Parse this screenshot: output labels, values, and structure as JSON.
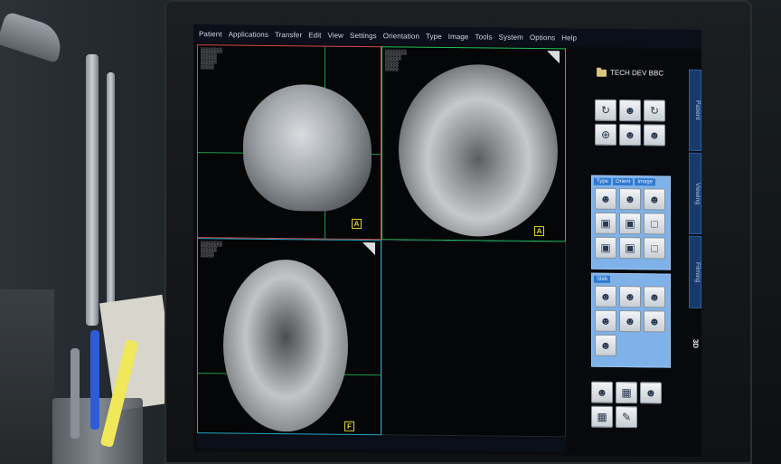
{
  "menu": [
    "Patient",
    "Applications",
    "Transfer",
    "Edit",
    "View",
    "Settings",
    "Orientation",
    "Type",
    "Image",
    "Tools",
    "System",
    "Options",
    "Help"
  ],
  "viewports": {
    "top_left": {
      "orient": "A"
    },
    "top_right": {
      "orient": "A"
    },
    "bottom_left": {
      "orient": "F"
    }
  },
  "panel": {
    "folder_label": "TECH DEV BBC",
    "side_tabs": [
      "Patient",
      "Viewing",
      "Filming"
    ],
    "mode_3d": "3D",
    "group1_tabs": [
      "Type",
      "Orient",
      "Image"
    ],
    "group2_tabs": [
      "Slab"
    ]
  },
  "icons": {
    "top_tools": [
      "rotate-icon",
      "head-icon",
      "rotate-icon",
      "orbit-icon",
      "head-icon",
      "head-icon"
    ],
    "group1_tools": [
      "head-icon",
      "head-icon",
      "head-icon",
      "cube-icon",
      "cube-icon",
      "square-icon",
      "cube-icon",
      "cube-icon",
      "square-icon"
    ],
    "group2_tools": [
      "head-icon",
      "head-icon",
      "head-icon",
      "head-icon",
      "head-icon",
      "head-icon",
      "head-icon"
    ],
    "bottom_tools": [
      "head-icon",
      "grid-icon",
      "head-icon",
      "grid-icon",
      "pen-icon"
    ]
  },
  "colors": {
    "crosshair": "#22c05a",
    "orient_marker": "#e0d32a",
    "panel_blue": "#7fb2e8",
    "tab_blue": "#2f79d0"
  }
}
